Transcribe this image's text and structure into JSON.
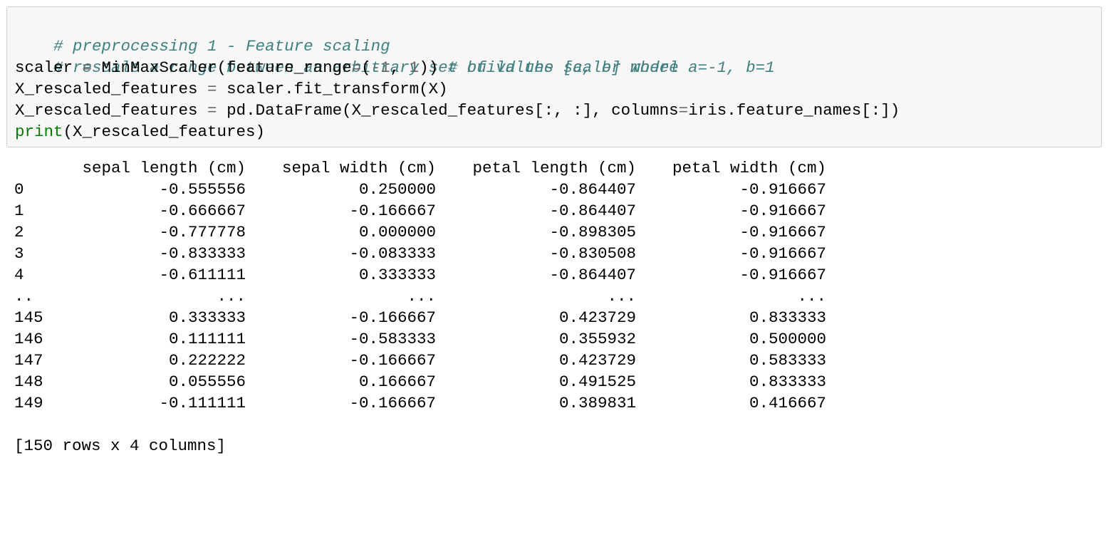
{
  "code": {
    "line1_comment": "# preprocessing 1 - Feature scaling",
    "line2_comment": "# rescale a range between an arbitrary set of values [a, b] where a=-1, b=1",
    "line3_a": "scaler ",
    "line3_eq": "=",
    "line3_b": " MinMaxScaler(feature_range",
    "line3_eq2": "=",
    "line3_c": "(",
    "line3_minus": "-",
    "line3_num1": "1",
    "line3_d": ", ",
    "line3_num2": "1",
    "line3_e": ")) ",
    "line3_comment": "# build the scaler model",
    "line4_a": "X_rescaled_features ",
    "line4_eq": "=",
    "line4_b": " scaler.fit_transform(X)",
    "line5_a": "X_rescaled_features ",
    "line5_eq": "=",
    "line5_b": " pd.DataFrame(X_rescaled_features[:, :], columns",
    "line5_eq2": "=",
    "line5_c": "iris.feature_names[:])",
    "line6_builtin": "print",
    "line6_rest": "(X_rescaled_features)"
  },
  "output": {
    "columns": [
      "sepal length (cm)",
      "sepal width (cm)",
      "petal length (cm)",
      "petal width (cm)"
    ],
    "rows": [
      {
        "index": "0",
        "values": [
          "-0.555556",
          "0.250000",
          "-0.864407",
          "-0.916667"
        ]
      },
      {
        "index": "1",
        "values": [
          "-0.666667",
          "-0.166667",
          "-0.864407",
          "-0.916667"
        ]
      },
      {
        "index": "2",
        "values": [
          "-0.777778",
          "0.000000",
          "-0.898305",
          "-0.916667"
        ]
      },
      {
        "index": "3",
        "values": [
          "-0.833333",
          "-0.083333",
          "-0.830508",
          "-0.916667"
        ]
      },
      {
        "index": "4",
        "values": [
          "-0.611111",
          "0.333333",
          "-0.864407",
          "-0.916667"
        ]
      },
      {
        "index": "..",
        "values": [
          "...",
          "...",
          "...",
          "..."
        ]
      },
      {
        "index": "145",
        "values": [
          "0.333333",
          "-0.166667",
          "0.423729",
          "0.833333"
        ]
      },
      {
        "index": "146",
        "values": [
          "0.111111",
          "-0.583333",
          "0.355932",
          "0.500000"
        ]
      },
      {
        "index": "147",
        "values": [
          "0.222222",
          "-0.166667",
          "0.423729",
          "0.583333"
        ]
      },
      {
        "index": "148",
        "values": [
          "0.055556",
          "0.166667",
          "0.491525",
          "0.833333"
        ]
      },
      {
        "index": "149",
        "values": [
          "-0.111111",
          "-0.166667",
          "0.389831",
          "0.416667"
        ]
      }
    ],
    "footer": "[150 rows x 4 columns]"
  },
  "colors": {
    "cell_background": "#f7f7f7",
    "cell_border": "#cfcfcf",
    "comment": "#408080",
    "builtin": "#008000",
    "number": "#666666"
  }
}
